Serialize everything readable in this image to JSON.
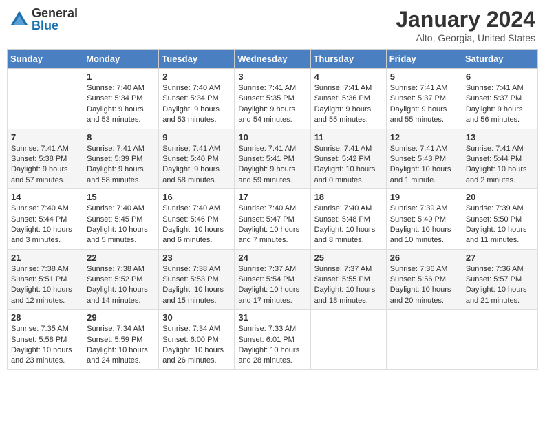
{
  "header": {
    "logo_general": "General",
    "logo_blue": "Blue",
    "month_title": "January 2024",
    "location": "Alto, Georgia, United States"
  },
  "weekdays": [
    "Sunday",
    "Monday",
    "Tuesday",
    "Wednesday",
    "Thursday",
    "Friday",
    "Saturday"
  ],
  "weeks": [
    [
      {
        "day": "",
        "info": ""
      },
      {
        "day": "1",
        "info": "Sunrise: 7:40 AM\nSunset: 5:34 PM\nDaylight: 9 hours\nand 53 minutes."
      },
      {
        "day": "2",
        "info": "Sunrise: 7:40 AM\nSunset: 5:34 PM\nDaylight: 9 hours\nand 53 minutes."
      },
      {
        "day": "3",
        "info": "Sunrise: 7:41 AM\nSunset: 5:35 PM\nDaylight: 9 hours\nand 54 minutes."
      },
      {
        "day": "4",
        "info": "Sunrise: 7:41 AM\nSunset: 5:36 PM\nDaylight: 9 hours\nand 55 minutes."
      },
      {
        "day": "5",
        "info": "Sunrise: 7:41 AM\nSunset: 5:37 PM\nDaylight: 9 hours\nand 55 minutes."
      },
      {
        "day": "6",
        "info": "Sunrise: 7:41 AM\nSunset: 5:37 PM\nDaylight: 9 hours\nand 56 minutes."
      }
    ],
    [
      {
        "day": "7",
        "info": "Sunrise: 7:41 AM\nSunset: 5:38 PM\nDaylight: 9 hours\nand 57 minutes."
      },
      {
        "day": "8",
        "info": "Sunrise: 7:41 AM\nSunset: 5:39 PM\nDaylight: 9 hours\nand 58 minutes."
      },
      {
        "day": "9",
        "info": "Sunrise: 7:41 AM\nSunset: 5:40 PM\nDaylight: 9 hours\nand 58 minutes."
      },
      {
        "day": "10",
        "info": "Sunrise: 7:41 AM\nSunset: 5:41 PM\nDaylight: 9 hours\nand 59 minutes."
      },
      {
        "day": "11",
        "info": "Sunrise: 7:41 AM\nSunset: 5:42 PM\nDaylight: 10 hours\nand 0 minutes."
      },
      {
        "day": "12",
        "info": "Sunrise: 7:41 AM\nSunset: 5:43 PM\nDaylight: 10 hours\nand 1 minute."
      },
      {
        "day": "13",
        "info": "Sunrise: 7:41 AM\nSunset: 5:44 PM\nDaylight: 10 hours\nand 2 minutes."
      }
    ],
    [
      {
        "day": "14",
        "info": "Sunrise: 7:40 AM\nSunset: 5:44 PM\nDaylight: 10 hours\nand 3 minutes."
      },
      {
        "day": "15",
        "info": "Sunrise: 7:40 AM\nSunset: 5:45 PM\nDaylight: 10 hours\nand 5 minutes."
      },
      {
        "day": "16",
        "info": "Sunrise: 7:40 AM\nSunset: 5:46 PM\nDaylight: 10 hours\nand 6 minutes."
      },
      {
        "day": "17",
        "info": "Sunrise: 7:40 AM\nSunset: 5:47 PM\nDaylight: 10 hours\nand 7 minutes."
      },
      {
        "day": "18",
        "info": "Sunrise: 7:40 AM\nSunset: 5:48 PM\nDaylight: 10 hours\nand 8 minutes."
      },
      {
        "day": "19",
        "info": "Sunrise: 7:39 AM\nSunset: 5:49 PM\nDaylight: 10 hours\nand 10 minutes."
      },
      {
        "day": "20",
        "info": "Sunrise: 7:39 AM\nSunset: 5:50 PM\nDaylight: 10 hours\nand 11 minutes."
      }
    ],
    [
      {
        "day": "21",
        "info": "Sunrise: 7:38 AM\nSunset: 5:51 PM\nDaylight: 10 hours\nand 12 minutes."
      },
      {
        "day": "22",
        "info": "Sunrise: 7:38 AM\nSunset: 5:52 PM\nDaylight: 10 hours\nand 14 minutes."
      },
      {
        "day": "23",
        "info": "Sunrise: 7:38 AM\nSunset: 5:53 PM\nDaylight: 10 hours\nand 15 minutes."
      },
      {
        "day": "24",
        "info": "Sunrise: 7:37 AM\nSunset: 5:54 PM\nDaylight: 10 hours\nand 17 minutes."
      },
      {
        "day": "25",
        "info": "Sunrise: 7:37 AM\nSunset: 5:55 PM\nDaylight: 10 hours\nand 18 minutes."
      },
      {
        "day": "26",
        "info": "Sunrise: 7:36 AM\nSunset: 5:56 PM\nDaylight: 10 hours\nand 20 minutes."
      },
      {
        "day": "27",
        "info": "Sunrise: 7:36 AM\nSunset: 5:57 PM\nDaylight: 10 hours\nand 21 minutes."
      }
    ],
    [
      {
        "day": "28",
        "info": "Sunrise: 7:35 AM\nSunset: 5:58 PM\nDaylight: 10 hours\nand 23 minutes."
      },
      {
        "day": "29",
        "info": "Sunrise: 7:34 AM\nSunset: 5:59 PM\nDaylight: 10 hours\nand 24 minutes."
      },
      {
        "day": "30",
        "info": "Sunrise: 7:34 AM\nSunset: 6:00 PM\nDaylight: 10 hours\nand 26 minutes."
      },
      {
        "day": "31",
        "info": "Sunrise: 7:33 AM\nSunset: 6:01 PM\nDaylight: 10 hours\nand 28 minutes."
      },
      {
        "day": "",
        "info": ""
      },
      {
        "day": "",
        "info": ""
      },
      {
        "day": "",
        "info": ""
      }
    ]
  ]
}
